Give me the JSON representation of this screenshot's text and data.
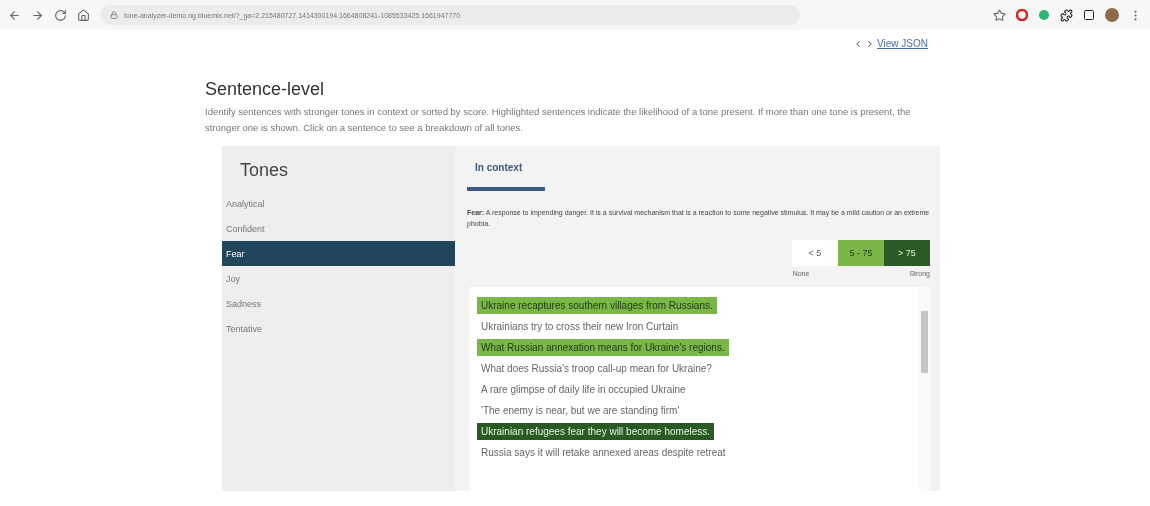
{
  "browser": {
    "url": "tone-analyzer-demo.ng.bluemix.net/?_ga=2.215480727.1414300194.1664808241-1085533425.1661947770"
  },
  "view_json_link": "View JSON",
  "section": {
    "title": "Sentence-level",
    "description": "Identify sentences with stronger tones in context or sorted by score. Highlighted sentences indicate the likelihood of a tone present. If more than one tone is present, the stronger one is shown. Click on a sentence to see a breakdown of all tones."
  },
  "tones": {
    "title": "Tones",
    "items": [
      {
        "label": "Analytical",
        "selected": false
      },
      {
        "label": "Confident",
        "selected": false
      },
      {
        "label": "Fear",
        "selected": true
      },
      {
        "label": "Joy",
        "selected": false
      },
      {
        "label": "Sadness",
        "selected": false
      },
      {
        "label": "Tentative",
        "selected": false
      }
    ]
  },
  "tabs": [
    {
      "label": "In context",
      "selected": true
    }
  ],
  "definition": "**Fear:** A response to impending danger. It is a survival mechanism that is a reaction to some negative stimulus. It may be a mild caution or an extreme phobia.",
  "legend": {
    "items": [
      {
        "label": "< 5",
        "kind": "none"
      },
      {
        "label": "5 - 75",
        "kind": "medium"
      },
      {
        "label": "> 75",
        "kind": "strong"
      }
    ],
    "low_label": "None",
    "high_label": "Strong"
  },
  "sentences": [
    {
      "text": "Ukraine recaptures southern villages from Russians.",
      "kind": "medium"
    },
    {
      "text": "Ukrainians try to cross their new Iron Curtain",
      "kind": "none"
    },
    {
      "text": "What Russian annexation means for Ukraine's regions.",
      "kind": "medium"
    },
    {
      "text": "What does Russia's troop call-up mean for Ukraine?",
      "kind": "none"
    },
    {
      "text": "A rare glimpse of daily life in occupied Ukraine",
      "kind": "none"
    },
    {
      "text": "'The enemy is near, but we are standing firm'",
      "kind": "none"
    },
    {
      "text": "Ukrainian refugees fear they will become homeless.",
      "kind": "strong"
    },
    {
      "text": "Russia says it will retake annexed areas despite retreat",
      "kind": "none"
    }
  ]
}
